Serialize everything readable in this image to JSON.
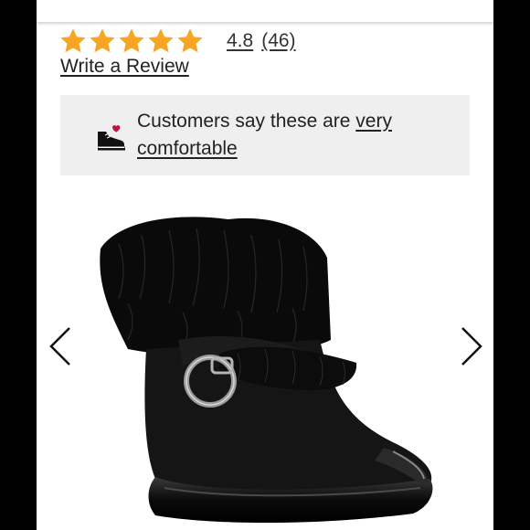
{
  "product": {
    "rating": {
      "stars": 5,
      "value": "4.8",
      "count": "(46)",
      "star_color": "#F5A623"
    },
    "write_review_label": "Write a Review",
    "callout": {
      "prefix": "Customers say these are ",
      "link_text_line1": "very",
      "link_text_line2": "comfortable",
      "icon": "sneaker-heart-icon",
      "heart_color": "#C4123F"
    },
    "image": {
      "alt": "Black faux-fur ankle boot with buckle strap"
    },
    "navigation": {
      "prev_icon": "chevron-left-icon",
      "next_icon": "chevron-right-icon"
    }
  }
}
